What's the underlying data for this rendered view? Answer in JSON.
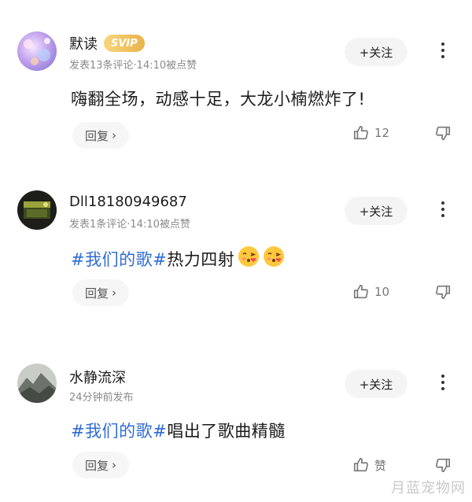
{
  "comments": [
    {
      "name": "默读",
      "badge": "SVIP",
      "meta": "发表13条评论·14:10被点赞",
      "follow_label": "+关注",
      "content": "嗨翻全场，动感十足，大龙小楠燃炸了!",
      "topic": "",
      "reply_label": "回复",
      "reply_chevron": "›",
      "like_count": "12"
    },
    {
      "name": "Dll18180949687",
      "badge": "",
      "meta": "发表1条评论·14:10被点赞",
      "follow_label": "+关注",
      "topic": "#我们的歌#",
      "content": "热力四射",
      "reply_label": "回复",
      "reply_chevron": "›",
      "like_count": "10"
    },
    {
      "name": "水静流深",
      "badge": "",
      "meta": "24分钟前发布",
      "follow_label": "+关注",
      "topic": "#我们的歌#",
      "content": "唱出了歌曲精髓",
      "reply_label": "回复",
      "reply_chevron": "›",
      "like_count": "赞"
    }
  ],
  "watermark": "月蓝宠物网",
  "colors": {
    "topic": "#2f6bd5",
    "svip": "#e9b34a"
  }
}
